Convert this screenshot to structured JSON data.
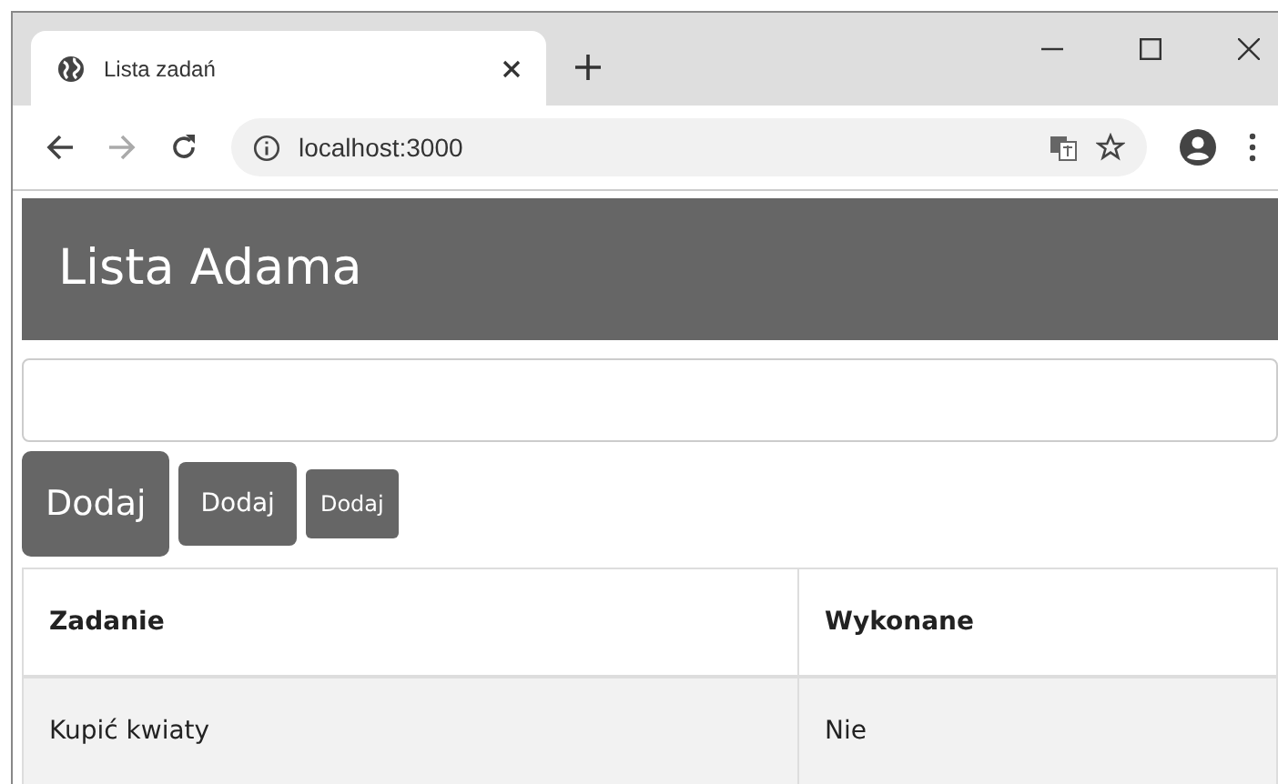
{
  "browser": {
    "tab": {
      "title": "Lista zadań"
    },
    "address": "localhost:3000"
  },
  "page": {
    "heading": "Lista Adama",
    "buttons": [
      {
        "label": "Dodaj",
        "kind": "large"
      },
      {
        "label": "Dodaj",
        "kind": "medium"
      },
      {
        "label": "Dodaj",
        "kind": "small"
      }
    ],
    "table": {
      "columns": [
        "Zadanie",
        "Wykonane"
      ],
      "rows": [
        [
          "Kupić kwiaty",
          "Nie"
        ]
      ]
    }
  }
}
